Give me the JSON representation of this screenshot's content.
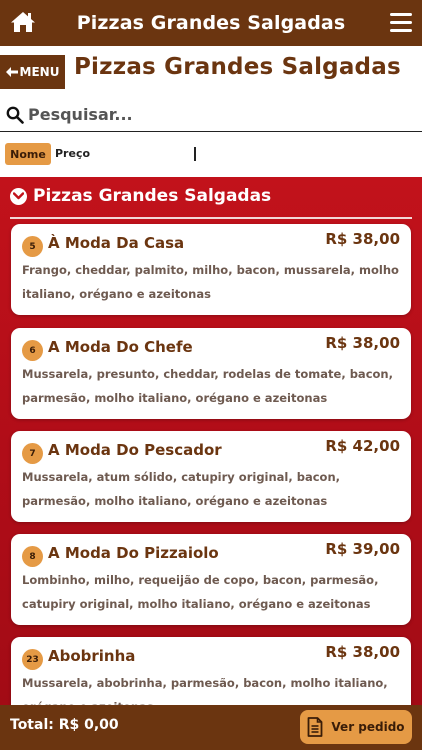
{
  "app": {
    "title": "Pizzas Grandes Salgadas"
  },
  "header": {
    "back_label": "MENU",
    "page_title": "Pizzas Grandes Salgadas"
  },
  "search": {
    "placeholder": "Pesquisar...",
    "value": ""
  },
  "sort": {
    "nome_label": "Nome",
    "preco_label": "Preço",
    "selected": "Nome"
  },
  "section": {
    "title": "Pizzas Grandes Salgadas"
  },
  "items": [
    {
      "number": "5",
      "name": "À Moda Da Casa",
      "price": "R$ 38,00",
      "description": "Frango, cheddar, palmito, milho, bacon, mussarela, molho italiano, orégano e azeitonas"
    },
    {
      "number": "6",
      "name": "A Moda Do Chefe",
      "price": "R$ 38,00",
      "description": "Mussarela, presunto, cheddar, rodelas de tomate, bacon, parmesão, molho italiano, orégano e azeitonas"
    },
    {
      "number": "7",
      "name": "A Moda Do Pescador",
      "price": "R$ 42,00",
      "description": "Mussarela, atum sólido, catupiry original, bacon, parmesão, molho italiano, orégano e azeitonas"
    },
    {
      "number": "8",
      "name": "A Moda Do Pizzaiolo",
      "price": "R$ 39,00",
      "description": "Lombinho, milho, requeijão de copo, bacon, parmesão, catupiry original, molho italiano, orégano e azeitonas"
    },
    {
      "number": "23",
      "name": "Abobrinha",
      "price": "R$ 38,00",
      "description": "Mussarela, abobrinha, parmesão, bacon, molho italiano, orégano e azeitonas"
    }
  ],
  "footer": {
    "total_label": "Total: R$ 0,00",
    "ver_pedido_label": "Ver pedido"
  },
  "colors": {
    "brand_brown": "#6b3510",
    "accent_orange": "#e59a45",
    "content_red": "#c2121b"
  },
  "icons": {
    "home": "home-icon",
    "menu": "hamburger-menu-icon",
    "back": "arrow-left-icon",
    "search": "search-icon",
    "section": "chevron-down-circle-icon",
    "order": "document-icon"
  }
}
